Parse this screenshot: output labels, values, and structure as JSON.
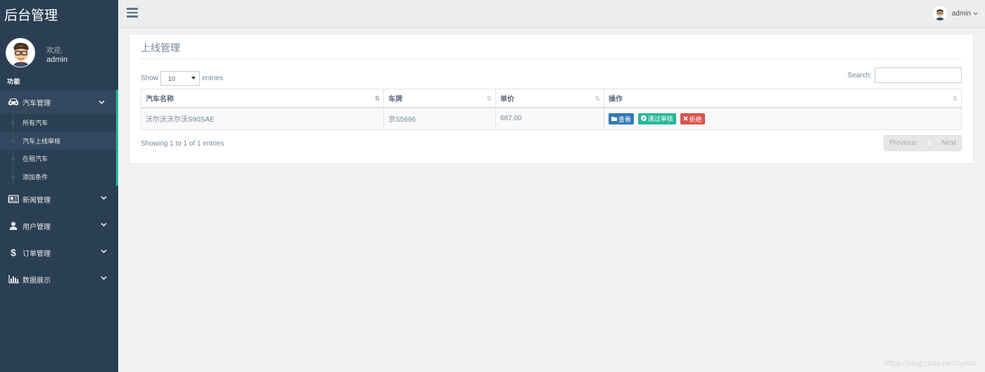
{
  "sidebar": {
    "brand": "后台管理",
    "welcome": "欢迎,",
    "username": "admin",
    "section": "功能",
    "menus": [
      {
        "label": "汽车管理",
        "icon": "car-icon"
      },
      {
        "label": "新闻管理",
        "icon": "newspaper-icon"
      },
      {
        "label": "用户管理",
        "icon": "user-icon"
      },
      {
        "label": "订单管理",
        "icon": "dollar-icon"
      },
      {
        "label": "数据展示",
        "icon": "bar-chart-icon"
      }
    ],
    "submenu": [
      "所有汽车",
      "汽车上线审核",
      "在租汽车",
      "添加条件"
    ]
  },
  "topnav": {
    "user": "admin"
  },
  "panel": {
    "title": "上线管理",
    "show_label": "Show",
    "entries_label": "entries",
    "page_length": "10",
    "search_label": "Search:",
    "search_value": ""
  },
  "table": {
    "columns": [
      "汽车名称",
      "车牌",
      "单价",
      "操作"
    ],
    "rows": [
      {
        "name": "沃尔沃沃尔沃S90SAE",
        "plate": "京S5696",
        "price": "687.00"
      }
    ],
    "actions": {
      "view": "查看",
      "approve": "通过审核",
      "reject": "拒绝"
    }
  },
  "footer": {
    "info": "Showing 1 to 1 of 1 entries",
    "previous": "Previous",
    "current_page": "1",
    "next": "Next"
  },
  "watermark": "https://blog.csdn.net/nyedn",
  "colors": {
    "sidebar": "#2a3f54",
    "accent": "#1abb9c",
    "primary": "#337ab7",
    "success": "#26b99a",
    "danger": "#d9534f"
  }
}
